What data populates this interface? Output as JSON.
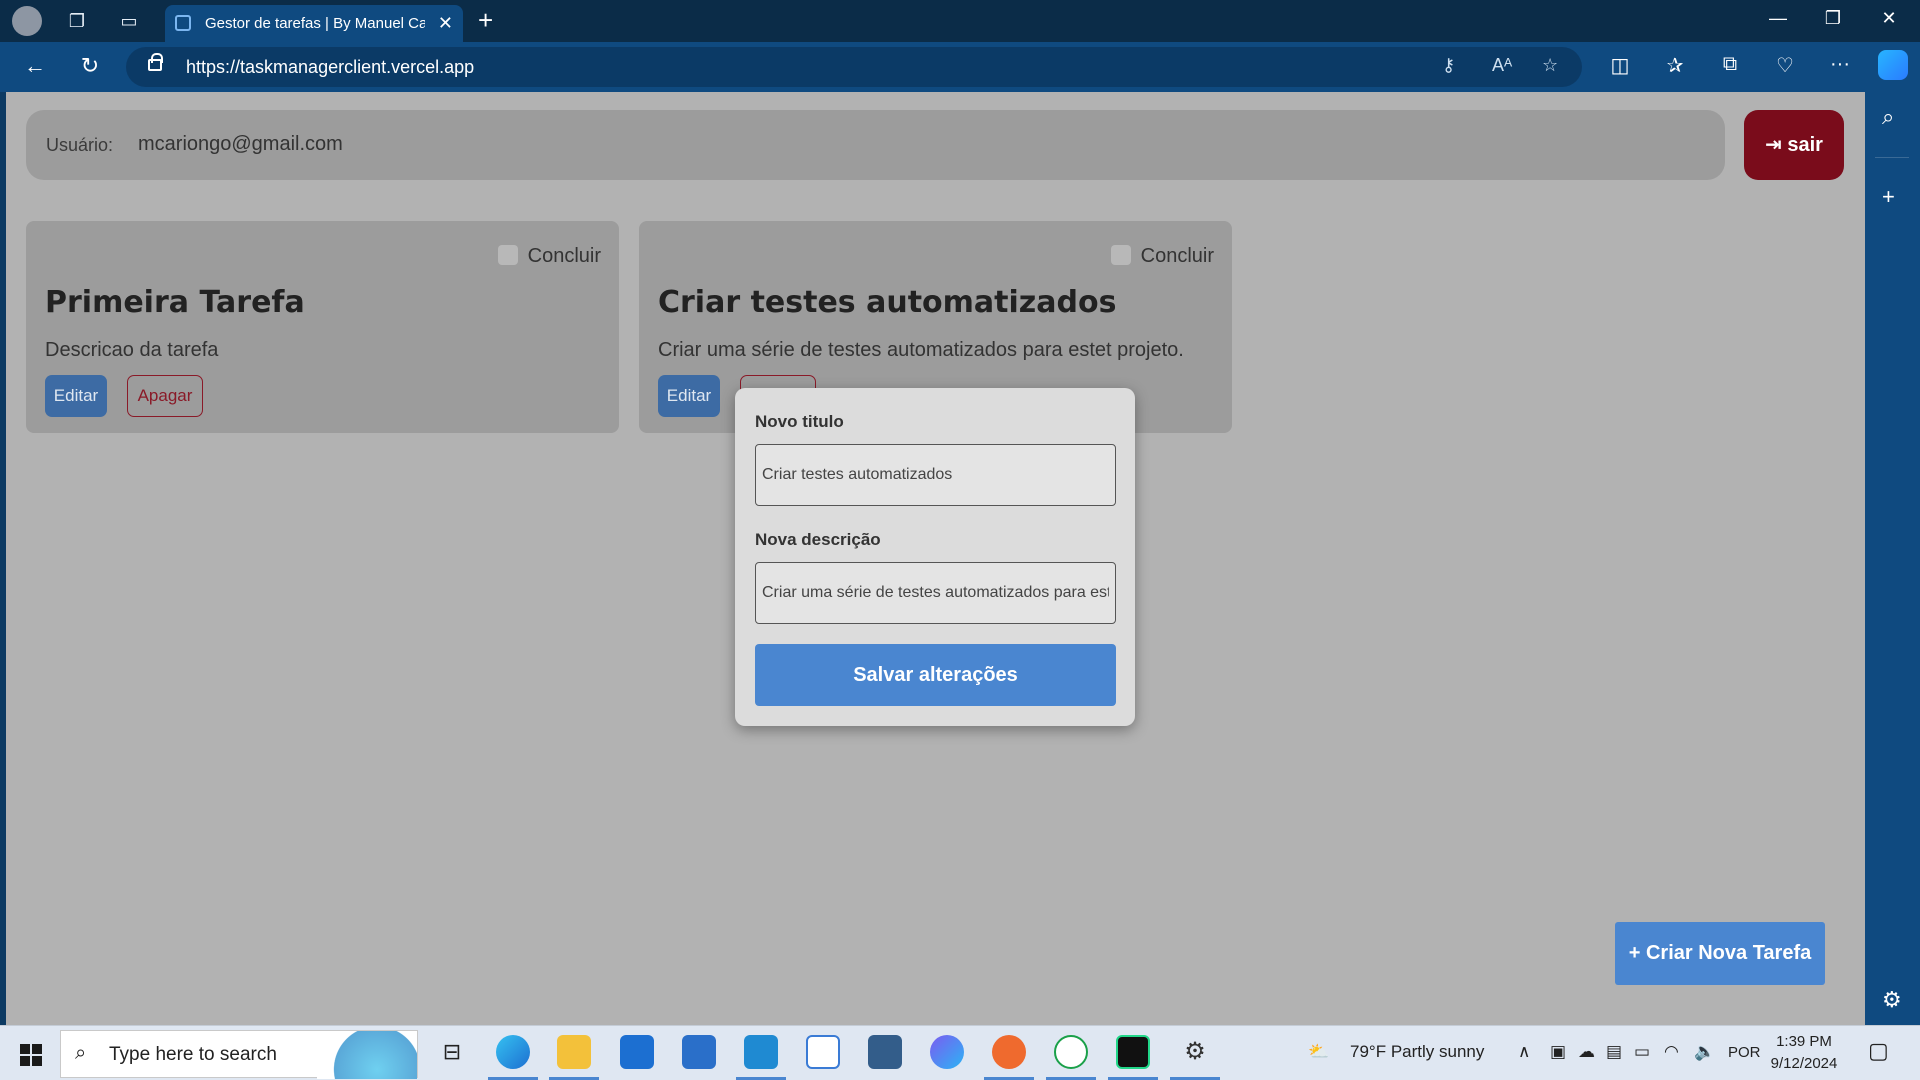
{
  "browser": {
    "tab_title": "Gestor de tarefas | By Manuel Carlos",
    "url": "https://taskmanagerclient.vercel.app"
  },
  "header": {
    "user_label": "Usuário:",
    "user_email": "mcariongo@gmail.com",
    "logout_label": "sair"
  },
  "tasks": [
    {
      "title": "Primeira Tarefa",
      "description": "Descricao da tarefa",
      "complete_label": "Concluir",
      "edit_label": "Editar",
      "delete_label": "Apagar"
    },
    {
      "title": "Criar testes automatizados",
      "description": "Criar uma série de testes automatizados para estet projeto.",
      "complete_label": "Concluir",
      "edit_label": "Editar",
      "delete_label": "Apagar"
    }
  ],
  "edit_modal": {
    "title_label": "Novo titulo",
    "title_value": "Criar testes automatizados",
    "description_label": "Nova descrição",
    "description_value": "Criar uma série de testes automatizados para estet projeto.",
    "save_label": "Salvar alterações"
  },
  "create_button_label": "+ Criar Nova Tarefa",
  "taskbar": {
    "search_placeholder": "Type here to search",
    "weather": "79°F  Partly sunny",
    "language": "POR",
    "time": "1:39 PM",
    "date": "9/12/2024"
  },
  "colors": {
    "logout": "#7a0c1b",
    "primary": "#4a86d0",
    "edit": "#3d6ba4",
    "delete_border": "#8a1a28"
  }
}
